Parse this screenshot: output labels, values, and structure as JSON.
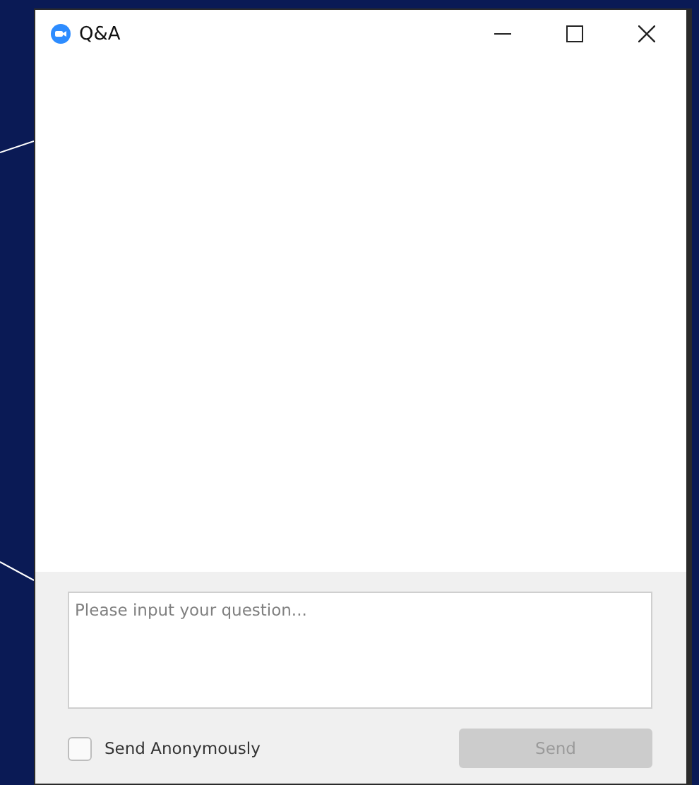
{
  "window": {
    "title": "Q&A"
  },
  "question": {
    "placeholder": "Please input your question..."
  },
  "anonymous": {
    "label": "Send Anonymously",
    "checked": false
  },
  "send_button": {
    "label": "Send",
    "disabled": true
  }
}
